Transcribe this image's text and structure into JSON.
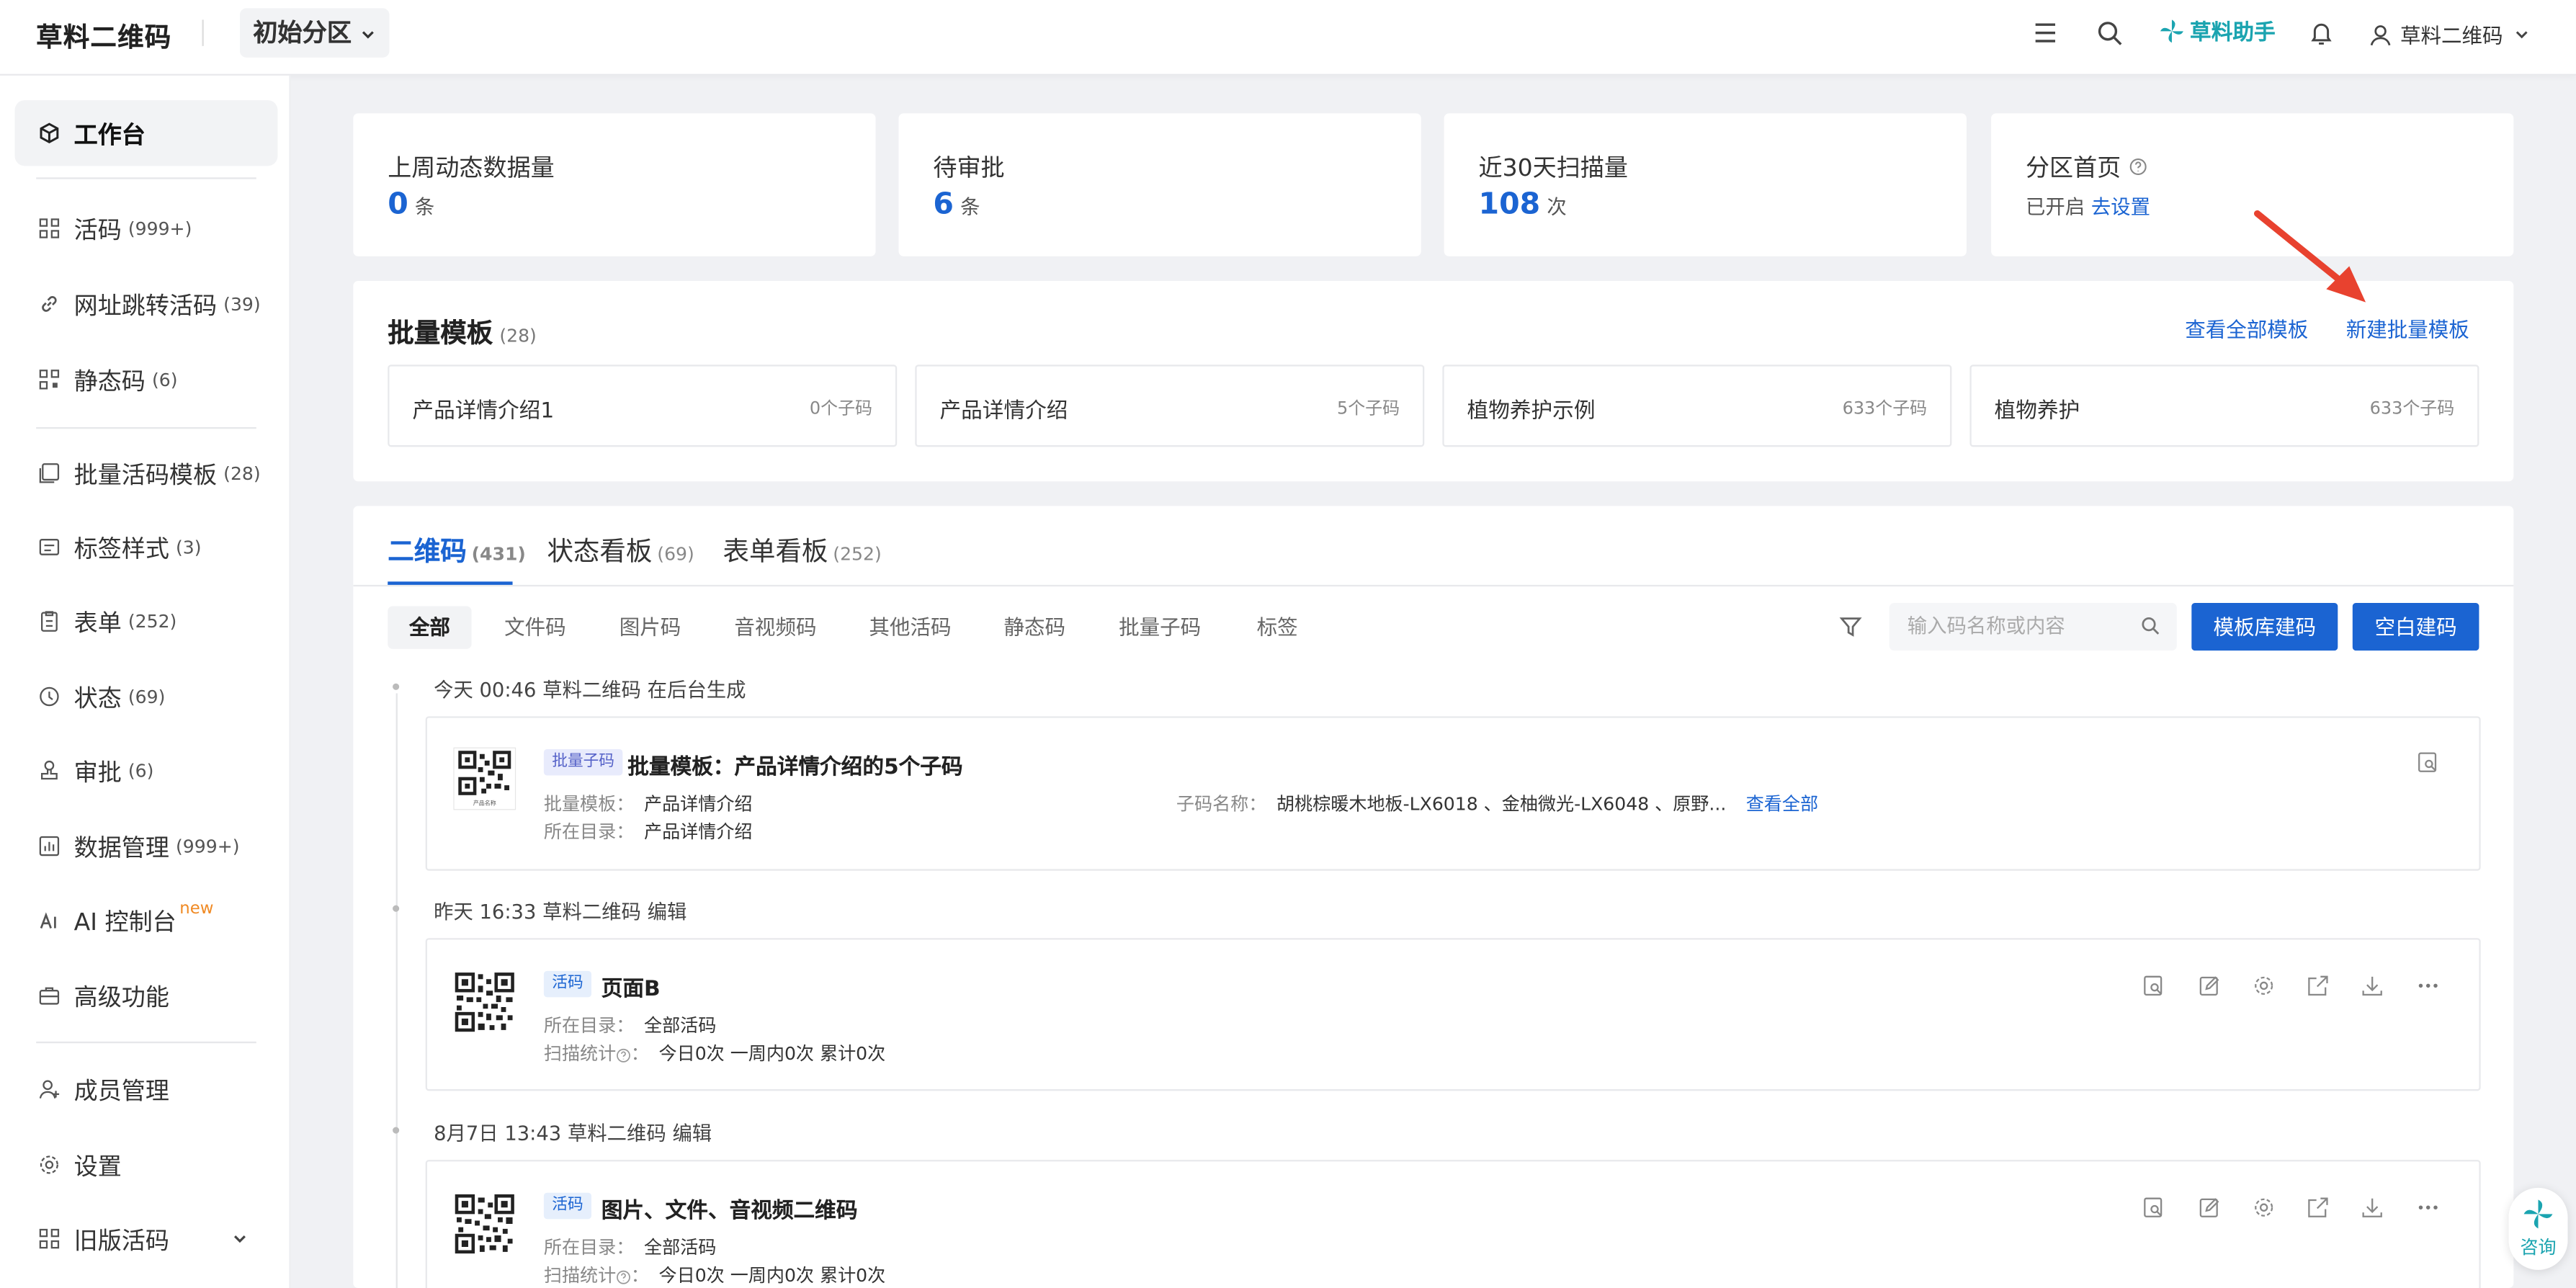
{
  "header": {
    "brand": "草料二维码",
    "zone": "初始分区",
    "helper": "草料助手",
    "user": "草料二维码"
  },
  "sidebar": {
    "workbench": "工作台",
    "items": [
      {
        "label": "活码",
        "count": "(999+)"
      },
      {
        "label": "网址跳转活码",
        "count": "(39)"
      },
      {
        "label": "静态码",
        "count": "(6)"
      },
      {
        "label": "批量活码模板",
        "count": "(28)"
      },
      {
        "label": "标签样式",
        "count": "(3)"
      },
      {
        "label": "表单",
        "count": "(252)"
      },
      {
        "label": "状态",
        "count": "(69)"
      },
      {
        "label": "审批",
        "count": "(6)"
      },
      {
        "label": "数据管理",
        "count": "(999+)"
      },
      {
        "label": "AI 控制台",
        "count": ""
      },
      {
        "label": "高级功能",
        "count": ""
      },
      {
        "label": "成员管理",
        "count": ""
      },
      {
        "label": "设置",
        "count": ""
      },
      {
        "label": "旧版活码",
        "count": ""
      }
    ],
    "new_tag": "new"
  },
  "stats": [
    {
      "title": "上周动态数据量",
      "value": "0",
      "unit": "条"
    },
    {
      "title": "待审批",
      "value": "6",
      "unit": "条"
    },
    {
      "title": "近30天扫描量",
      "value": "108",
      "unit": "次"
    },
    {
      "title": "分区首页",
      "status": "已开启",
      "link": "去设置"
    }
  ],
  "batch": {
    "title": "批量模板",
    "count": "(28)",
    "view_all": "查看全部模板",
    "create": "新建批量模板",
    "templates": [
      {
        "name": "产品详情介绍1",
        "count": "0个子码"
      },
      {
        "name": "产品详情介绍",
        "count": "5个子码"
      },
      {
        "name": "植物养护示例",
        "count": "633个子码"
      },
      {
        "name": "植物养护",
        "count": "633个子码"
      }
    ]
  },
  "main": {
    "tabs": [
      {
        "label": "二维码",
        "count": "(431)"
      },
      {
        "label": "状态看板",
        "count": "(69)"
      },
      {
        "label": "表单看板",
        "count": "(252)"
      }
    ],
    "filters": [
      "全部",
      "文件码",
      "图片码",
      "音视频码",
      "其他活码",
      "静态码",
      "批量子码",
      "标签"
    ],
    "search_placeholder": "输入码名称或内容",
    "btn_template": "模板库建码",
    "btn_blank": "空白建码",
    "entries": [
      {
        "log": "今天 00:46  草料二维码  在后台生成",
        "badge": "批量子码",
        "title": "批量模板：产品详情介绍的5个子码",
        "meta1_label": "批量模板：",
        "meta1_value": "产品详情介绍",
        "meta2_label": "所在目录：",
        "meta2_value": "产品详情介绍",
        "sub_label": "子码名称：",
        "sub_value": "胡桃棕暖木地板-LX6018 、金柚微光-LX6048 、原野...",
        "sub_link": "查看全部",
        "qr_caption": "产品名称"
      },
      {
        "log": "昨天 16:33  草料二维码  编辑",
        "badge": "活码",
        "title": "页面B",
        "meta1_label": "所在目录：",
        "meta1_value": "全部活码",
        "meta2_label": "扫描统计",
        "meta2_value": "今日0次  一周内0次  累计0次"
      },
      {
        "log": "8月7日 13:43  草料二维码  编辑",
        "badge": "活码",
        "title": "图片、文件、音视频二维码",
        "meta1_label": "所在目录：",
        "meta1_value": "全部活码",
        "meta2_label": "扫描统计",
        "meta2_value": "今日0次  一周内0次  累计0次"
      }
    ]
  },
  "consult": "咨询",
  "colors": {
    "accent": "#1b64d2",
    "helper": "#1ba4b0",
    "arrow": "#e8422f"
  }
}
